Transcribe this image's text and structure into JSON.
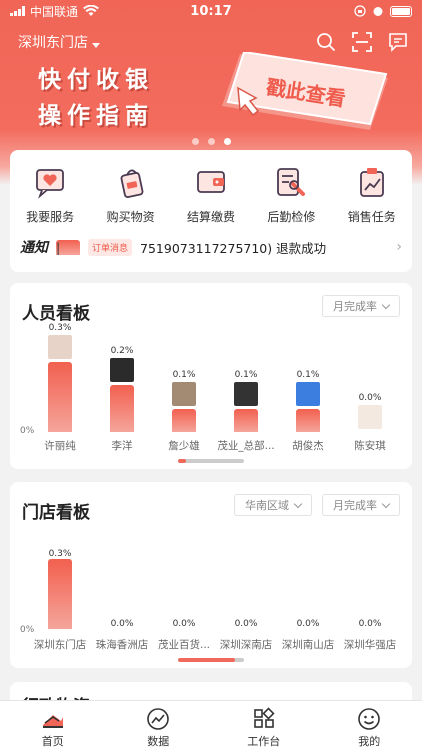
{
  "status": {
    "carrier": "中国联通",
    "time": "10:17"
  },
  "header": {
    "store_name": "深圳东门店"
  },
  "banner": {
    "line1": "快付收银",
    "line2": "操作指南",
    "button_text": "戳此查看"
  },
  "services": [
    {
      "label": "我要服务",
      "icon": "heart-chat-icon"
    },
    {
      "label": "购买物资",
      "icon": "shopping-bag-icon"
    },
    {
      "label": "结算缴费",
      "icon": "wallet-icon"
    },
    {
      "label": "后勤检修",
      "icon": "wrench-doc-icon"
    },
    {
      "label": "销售任务",
      "icon": "task-chart-icon"
    }
  ],
  "notice": {
    "title": "通知",
    "tag": "订单消息",
    "text": "7519073117275710) 退款成功"
  },
  "staff_board": {
    "title": "人员看板",
    "filter": "月完成率",
    "zero_label": "0%"
  },
  "store_board": {
    "title": "门店看板",
    "region_filter": "华南区域",
    "filter": "月完成率",
    "zero_label": "0%"
  },
  "next_section": {
    "title": "行政物资"
  },
  "tabs": [
    {
      "label": "首页",
      "icon": "home-icon"
    },
    {
      "label": "数据",
      "icon": "data-icon"
    },
    {
      "label": "工作台",
      "icon": "workbench-icon"
    },
    {
      "label": "我的",
      "icon": "profile-icon"
    }
  ],
  "chart_data": [
    {
      "type": "bar",
      "title": "人员看板",
      "categories": [
        "许丽纯",
        "李洋",
        "詹少雄",
        "茂业_总部...",
        "胡俊杰",
        "陈安琪"
      ],
      "values": [
        0.3,
        0.2,
        0.1,
        0.1,
        0.1,
        0.0
      ],
      "value_labels": [
        "0.3%",
        "0.2%",
        "0.1%",
        "0.1%",
        "0.1%",
        "0.0%"
      ],
      "ylabel": "",
      "ylim": [
        0,
        0.3
      ],
      "unit": "%"
    },
    {
      "type": "bar",
      "title": "门店看板",
      "categories": [
        "深圳东门店",
        "珠海香洲店",
        "茂业百货...",
        "深圳深南店",
        "深圳南山店",
        "深圳华强店"
      ],
      "values": [
        0.3,
        0.0,
        0.0,
        0.0,
        0.0,
        0.0
      ],
      "value_labels": [
        "0.3%",
        "0.0%",
        "0.0%",
        "0.0%",
        "0.0%",
        "0.0%"
      ],
      "ylabel": "",
      "ylim": [
        0,
        0.3
      ],
      "unit": "%"
    }
  ],
  "colors": {
    "accent": "#f06556",
    "bar_top": "#f2604f",
    "bar_bottom": "#f5a59b"
  }
}
